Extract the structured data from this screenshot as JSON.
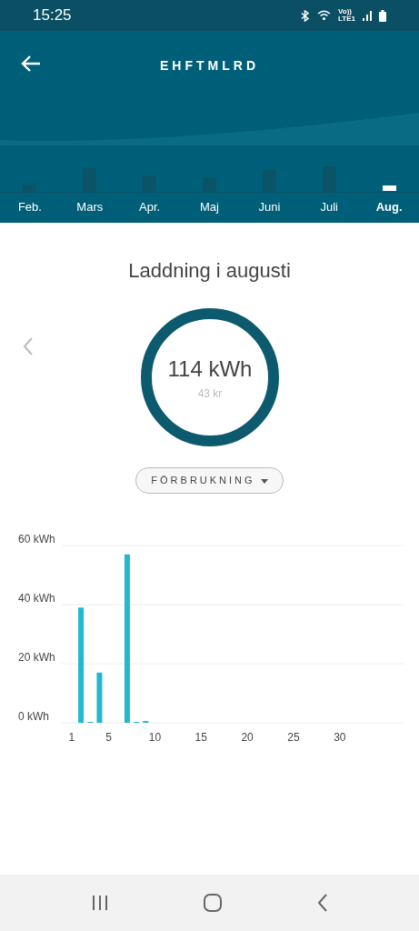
{
  "status_bar": {
    "time": "15:25",
    "network_top": "Vo))",
    "network_bottom": "LTE1"
  },
  "header": {
    "title": "EHFTMLRD"
  },
  "months": [
    {
      "label": "Feb.",
      "selected": false
    },
    {
      "label": "Mars",
      "selected": false
    },
    {
      "label": "Apr.",
      "selected": false
    },
    {
      "label": "Maj",
      "selected": false
    },
    {
      "label": "Juni",
      "selected": false
    },
    {
      "label": "Juli",
      "selected": false
    },
    {
      "label": "Aug.",
      "selected": true
    }
  ],
  "summary": {
    "title": "Laddning i augusti",
    "energy": "114 kWh",
    "cost": "43 kr",
    "dropdown": "FÖRBRUKNING"
  },
  "chart": {
    "chart_data": {
      "type": "bar",
      "x": [
        1,
        2,
        3,
        4,
        5,
        6,
        7,
        8,
        9,
        10,
        11,
        12,
        13,
        14,
        15,
        16,
        17,
        18,
        19,
        20,
        21,
        22,
        23,
        24,
        25,
        26,
        27,
        28,
        29,
        30,
        31
      ],
      "values": [
        0,
        39,
        0.2,
        17,
        0,
        0,
        57,
        0.3,
        0.6,
        0,
        0,
        0,
        0,
        0,
        0,
        0,
        0,
        0,
        0,
        0,
        0,
        0,
        0,
        0,
        0,
        0,
        0,
        0,
        0,
        0,
        0
      ],
      "ylim": [
        0,
        60
      ],
      "xlim": [
        0,
        37
      ],
      "xticks": [
        1,
        5,
        10,
        15,
        20,
        25,
        30
      ],
      "yticks": [
        {
          "value": 0,
          "label": "0 kWh"
        },
        {
          "value": 20,
          "label": "20 kWh"
        },
        {
          "value": 40,
          "label": "40 kWh"
        },
        {
          "value": 60,
          "label": "60 kWh"
        }
      ]
    }
  }
}
